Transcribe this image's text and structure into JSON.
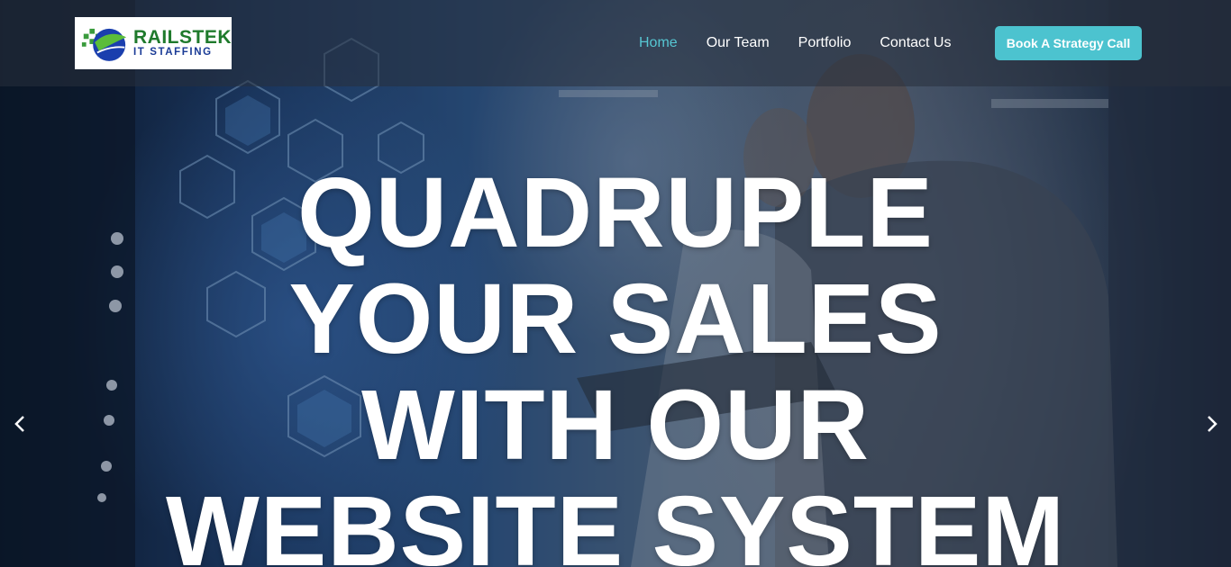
{
  "logo": {
    "name": "RAILSTEK",
    "sub": "IT STAFFING"
  },
  "nav": {
    "items": [
      {
        "label": "Home",
        "active": true
      },
      {
        "label": "Our Team",
        "active": false
      },
      {
        "label": "Portfolio",
        "active": false
      },
      {
        "label": "Contact Us",
        "active": false
      }
    ],
    "cta": "Book A Strategy Call"
  },
  "hero": {
    "lines": [
      "QUADRUPLE",
      "YOUR SALES",
      "WITH OUR",
      "WEBSITE SYSTEM"
    ]
  },
  "icons": {
    "prev": "chevron-left-icon",
    "next": "chevron-right-icon"
  },
  "colors": {
    "accent": "#4cc3cf",
    "active_link": "#56c6d2",
    "logo_green": "#1f7a2c",
    "logo_blue": "#1a3b96"
  }
}
